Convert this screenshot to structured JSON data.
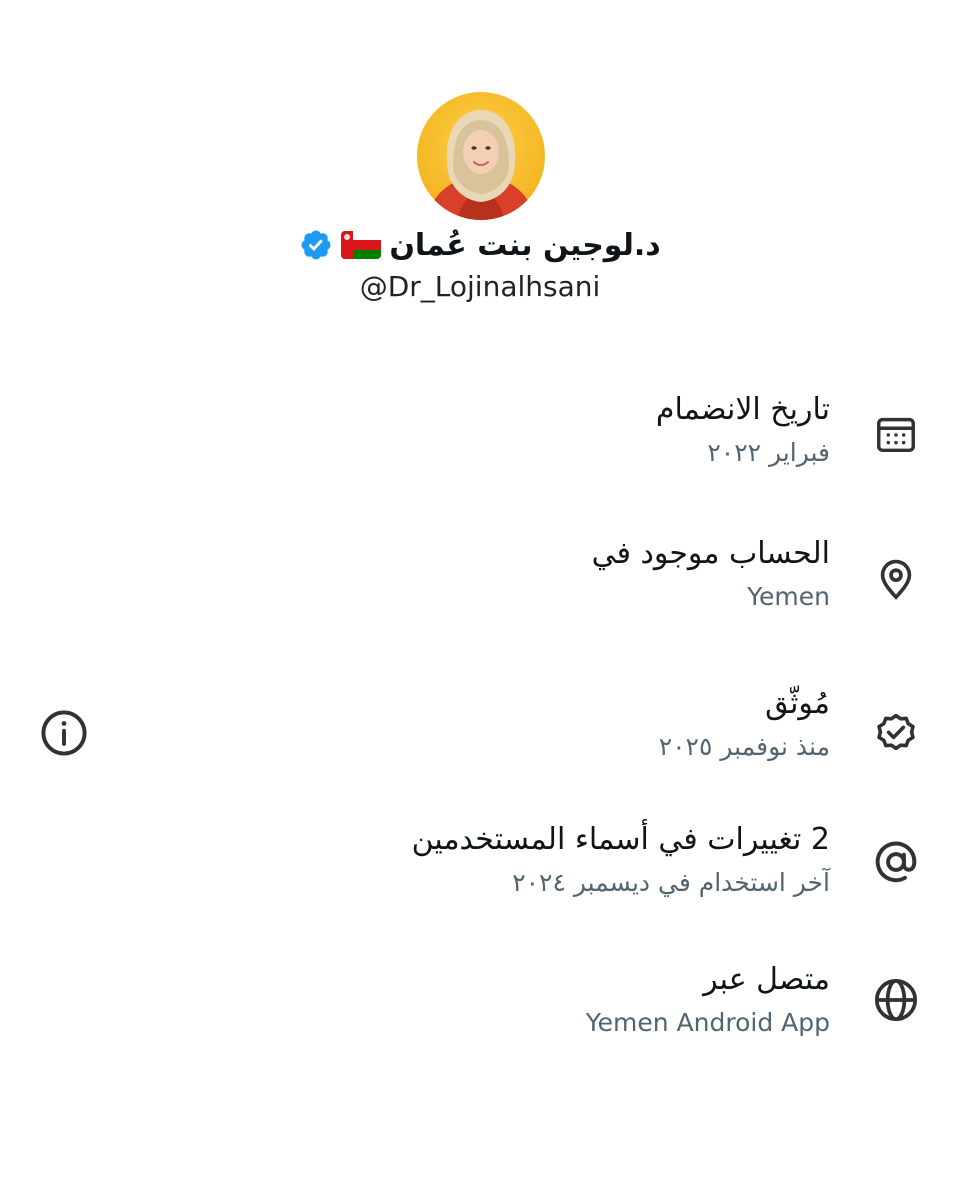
{
  "profile": {
    "display_name": "د.لوجين بنت عُمان",
    "handle": "@Dr_Lojinalhsani",
    "flag": "oman-flag",
    "verified": "verified-badge-icon",
    "avatar": "avatar-photo"
  },
  "rows": [
    {
      "title": "تاريخ الانضمام",
      "subtitle": "فبراير ٢٠٢٢",
      "icon": "calendar-icon"
    },
    {
      "title": "الحساب موجود في",
      "subtitle": "Yemen",
      "icon": "location-pin-icon"
    },
    {
      "title": "مُوثّق",
      "subtitle": "منذ نوفمبر ٢٠٢٥",
      "icon": "verified-check-icon"
    },
    {
      "title": "2 تغييرات في أسماء المستخدمين",
      "subtitle": "آخر استخدام في ديسمبر ٢٠٢٤",
      "icon": "at-sign-icon"
    },
    {
      "title": "متصل عبر",
      "subtitle": "Yemen Android App",
      "icon": "globe-icon"
    }
  ],
  "info_icon": "info-icon",
  "colors": {
    "primary_text": "#0f1419",
    "secondary_text": "#536471",
    "verified_blue": "#1d9bf0",
    "icon_color": "#2f3336"
  }
}
